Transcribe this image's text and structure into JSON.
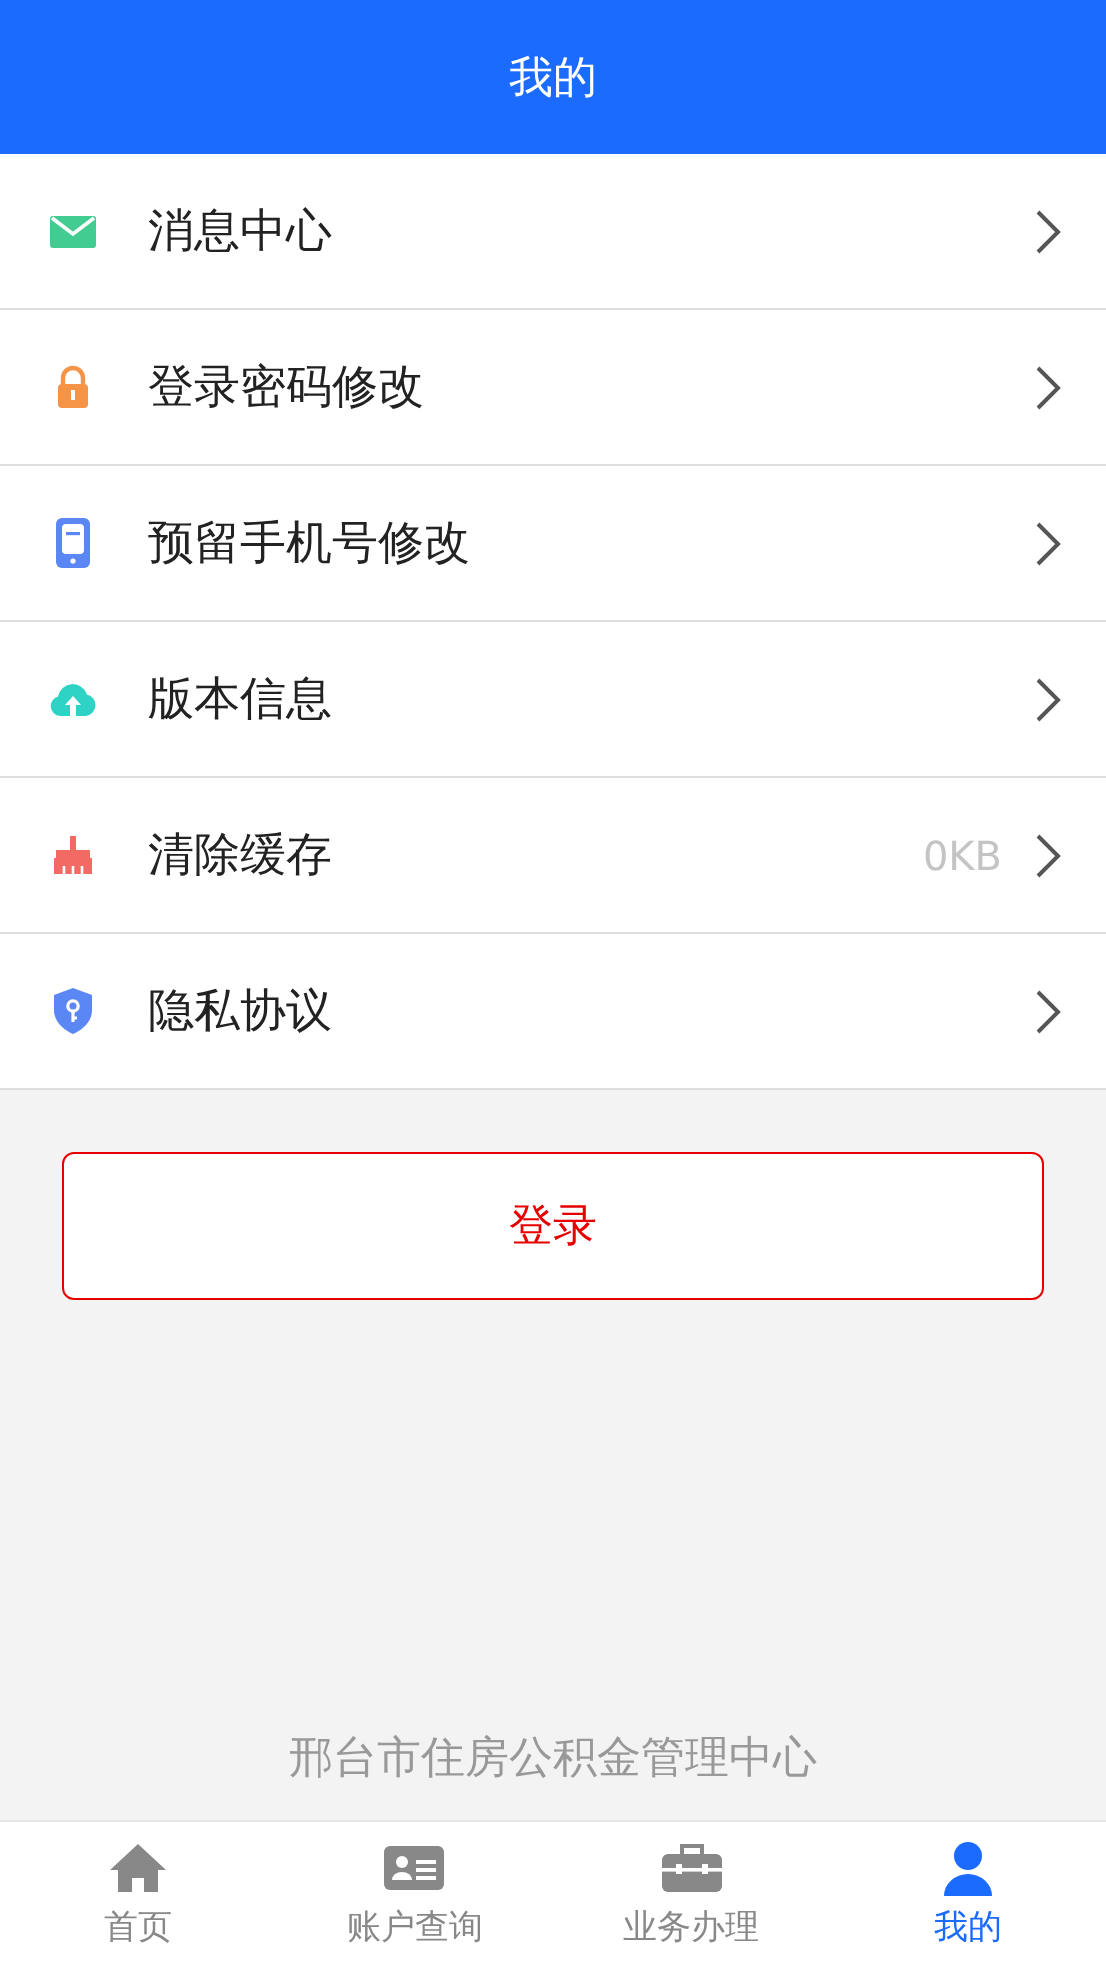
{
  "header": {
    "title": "我的"
  },
  "menu": [
    {
      "kind": "mail",
      "label": "消息中心"
    },
    {
      "kind": "lock",
      "label": "登录密码修改"
    },
    {
      "kind": "phone",
      "label": "预留手机号修改"
    },
    {
      "kind": "cloud",
      "label": "版本信息"
    },
    {
      "kind": "broom",
      "label": "清除缓存",
      "value": "0KB"
    },
    {
      "kind": "shield",
      "label": "隐私协议"
    }
  ],
  "login_button": "登录",
  "footer": "邢台市住房公积金管理中心",
  "tab_bar": [
    {
      "kind": "home",
      "label": "首页",
      "selected": false
    },
    {
      "kind": "card",
      "label": "账户查询",
      "selected": false
    },
    {
      "kind": "briefcase",
      "label": "业务办理",
      "selected": false
    },
    {
      "kind": "person",
      "label": "我的",
      "selected": true
    }
  ]
}
